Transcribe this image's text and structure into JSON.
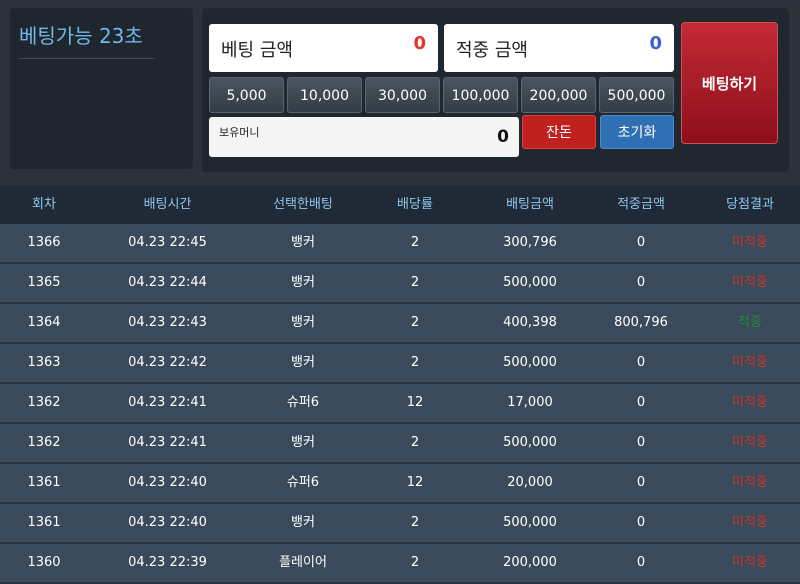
{
  "timer": {
    "title": "베팅가능 23초"
  },
  "bet_amount": {
    "label": "베팅 금액",
    "value": "0",
    "color": "#e8322c"
  },
  "win_amount": {
    "label": "적중 금액",
    "value": "0",
    "color": "#3a5fd8"
  },
  "chips": [
    "5,000",
    "10,000",
    "30,000",
    "100,000",
    "200,000",
    "500,000"
  ],
  "balance": {
    "label": "보유머니",
    "value": "0"
  },
  "buttons": {
    "change": "잔돈",
    "reset": "초기화",
    "bet": "베팅하기"
  },
  "colors": {
    "change_bg": "#c0201e",
    "reset_bg": "#2f6fb3",
    "miss": "#c0392b",
    "hit": "#1f8a3a",
    "header_text": "#8ec6ee"
  },
  "table": {
    "headers": [
      "회차",
      "배팅시간",
      "선택한배팅",
      "배당률",
      "배팅금액",
      "적중금액",
      "당첨결과"
    ],
    "rows": [
      [
        "1366",
        "04.23 22:45",
        "뱅커",
        "2",
        "300,796",
        "0",
        "미적중"
      ],
      [
        "1365",
        "04.23 22:44",
        "뱅커",
        "2",
        "500,000",
        "0",
        "미적중"
      ],
      [
        "1364",
        "04.23 22:43",
        "뱅커",
        "2",
        "400,398",
        "800,796",
        "적중"
      ],
      [
        "1363",
        "04.23 22:42",
        "뱅커",
        "2",
        "500,000",
        "0",
        "미적중"
      ],
      [
        "1362",
        "04.23 22:41",
        "슈퍼6",
        "12",
        "17,000",
        "0",
        "미적중"
      ],
      [
        "1362",
        "04.23 22:41",
        "뱅커",
        "2",
        "500,000",
        "0",
        "미적중"
      ],
      [
        "1361",
        "04.23 22:40",
        "슈퍼6",
        "12",
        "20,000",
        "0",
        "미적중"
      ],
      [
        "1361",
        "04.23 22:40",
        "뱅커",
        "2",
        "500,000",
        "0",
        "미적중"
      ],
      [
        "1360",
        "04.23 22:39",
        "플레이어",
        "2",
        "200,000",
        "0",
        "미적중"
      ]
    ]
  }
}
